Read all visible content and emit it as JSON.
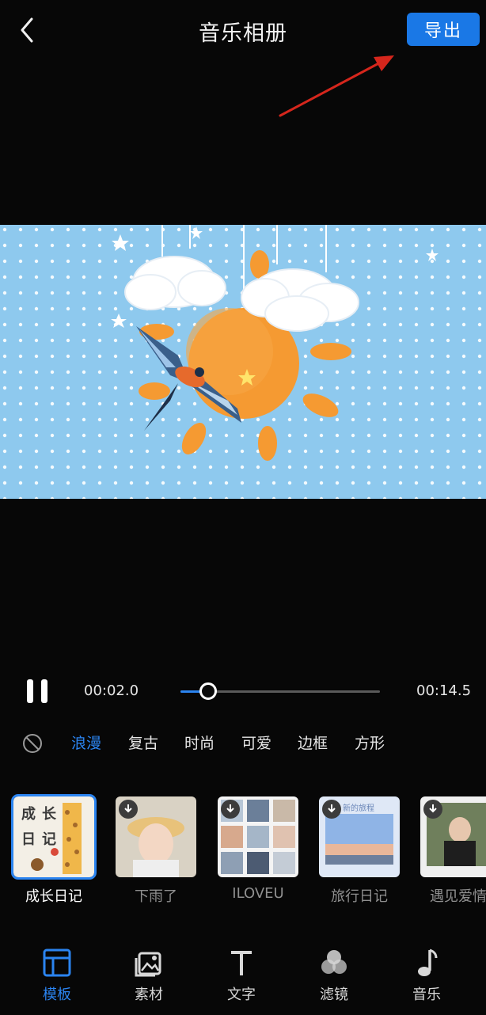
{
  "header": {
    "title": "音乐相册",
    "export_label": "导出",
    "back_icon": "chevron-left-icon"
  },
  "annotation": {
    "arrow_color": "#d5261c"
  },
  "playback": {
    "current_time": "00:02.0",
    "total_time": "00:14.5",
    "progress": 0.14,
    "state_icon": "pause-icon"
  },
  "categories": {
    "none_icon": "no-effect-icon",
    "items": [
      "浪漫",
      "复古",
      "时尚",
      "可爱",
      "边框",
      "方形"
    ],
    "active_index": 0
  },
  "templates": {
    "items": [
      {
        "label": "成长日记",
        "thumb_text": [
          "成",
          "长",
          "日",
          "记"
        ],
        "selected": true,
        "download": false
      },
      {
        "label": "下雨了",
        "selected": false,
        "download": true
      },
      {
        "label": "ILOVEU",
        "selected": false,
        "download": true
      },
      {
        "label": "旅行日记",
        "thumb_text": "新的旅程",
        "selected": false,
        "download": true
      },
      {
        "label": "遇见爱情",
        "selected": false,
        "download": true
      }
    ]
  },
  "bottom_nav": {
    "items": [
      {
        "label": "模板",
        "icon": "template-icon",
        "active": true
      },
      {
        "label": "素材",
        "icon": "material-icon",
        "active": false
      },
      {
        "label": "文字",
        "icon": "text-icon",
        "active": false
      },
      {
        "label": "滤镜",
        "icon": "filter-icon",
        "active": false
      },
      {
        "label": "音乐",
        "icon": "music-icon",
        "active": false
      }
    ]
  },
  "colors": {
    "accent": "#2b84f0",
    "export_bg": "#1a78e6",
    "background": "#070707",
    "preview_sky": "#8ec9ee",
    "sun": "#f59a32"
  }
}
